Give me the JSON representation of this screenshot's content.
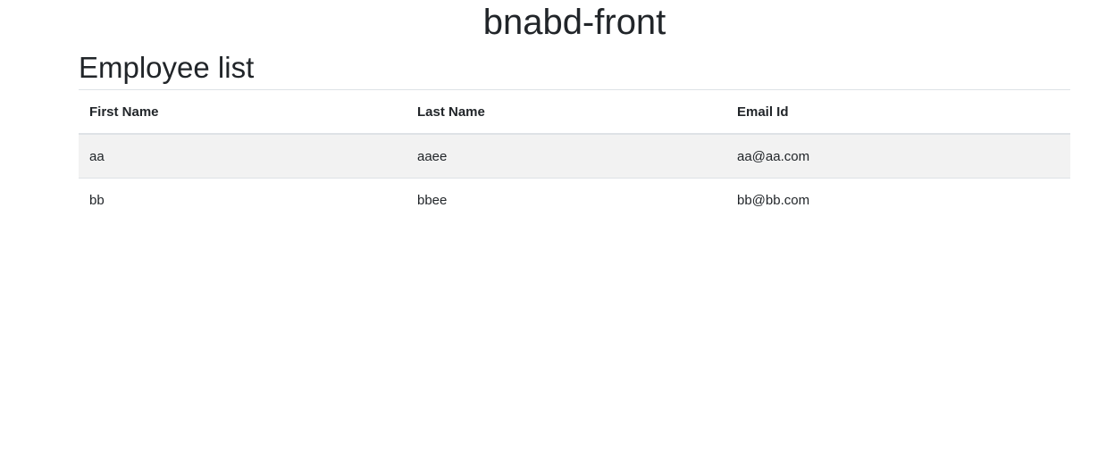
{
  "app": {
    "title": "bnabd-front"
  },
  "main": {
    "heading": "Employee list",
    "table": {
      "columns": [
        "First Name",
        "Last Name",
        "Email Id"
      ],
      "rows": [
        [
          "aa",
          "aaee",
          "aa@aa.com"
        ],
        [
          "bb",
          "bbee",
          "bb@bb.com"
        ]
      ]
    }
  }
}
